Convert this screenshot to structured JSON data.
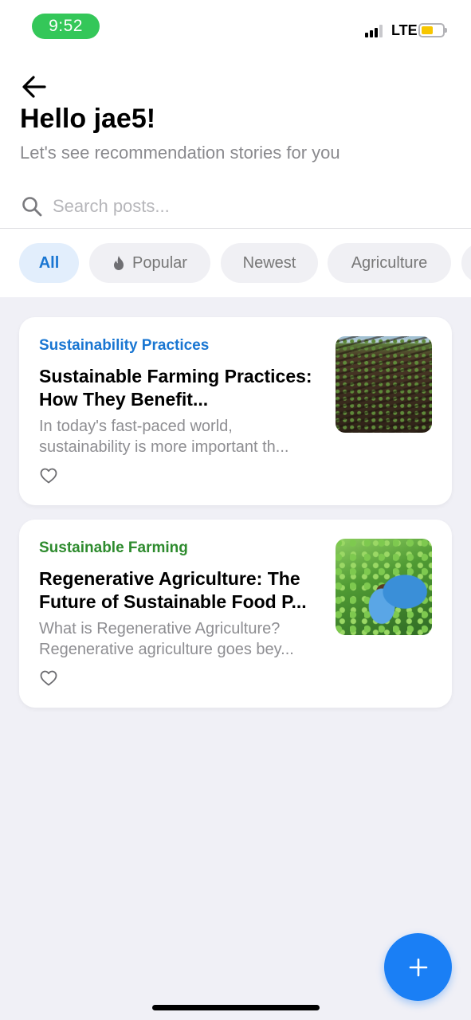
{
  "status_bar": {
    "time": "9:52",
    "network": "LTE",
    "time_pill_color": "#34c759",
    "battery_color": "#f7c600"
  },
  "header": {
    "back_icon": "arrow-left-icon",
    "title": "Hello jae5!",
    "subtitle": "Let's see recommendation stories for you"
  },
  "search": {
    "icon": "search-icon",
    "placeholder": "Search posts...",
    "value": ""
  },
  "filters": [
    {
      "label": "All",
      "active": true
    },
    {
      "label": "Popular",
      "icon": "flame-icon",
      "active": false
    },
    {
      "label": "Newest",
      "active": false
    },
    {
      "label": "Agriculture",
      "active": false
    }
  ],
  "posts": [
    {
      "category": "Sustainability Practices",
      "category_color": "#1976d2",
      "title": "Sustainable Farming Practices: How They Benefit...",
      "excerpt": "In today's fast-paced world, sustainability is more important th...",
      "image": "plowed-field-seedlings",
      "like_icon": "heart-outline-icon"
    },
    {
      "category": "Sustainable Farming",
      "category_color": "#2e8b2e",
      "title": "Regenerative Agriculture: The Future of Sustainable Food P...",
      "excerpt": "What is Regenerative Agriculture? Regenerative agriculture goes bey...",
      "image": "gloved-hands-holding-seedling",
      "like_icon": "heart-outline-icon"
    }
  ],
  "fab": {
    "icon": "plus-icon",
    "color": "#1a7ff5"
  }
}
